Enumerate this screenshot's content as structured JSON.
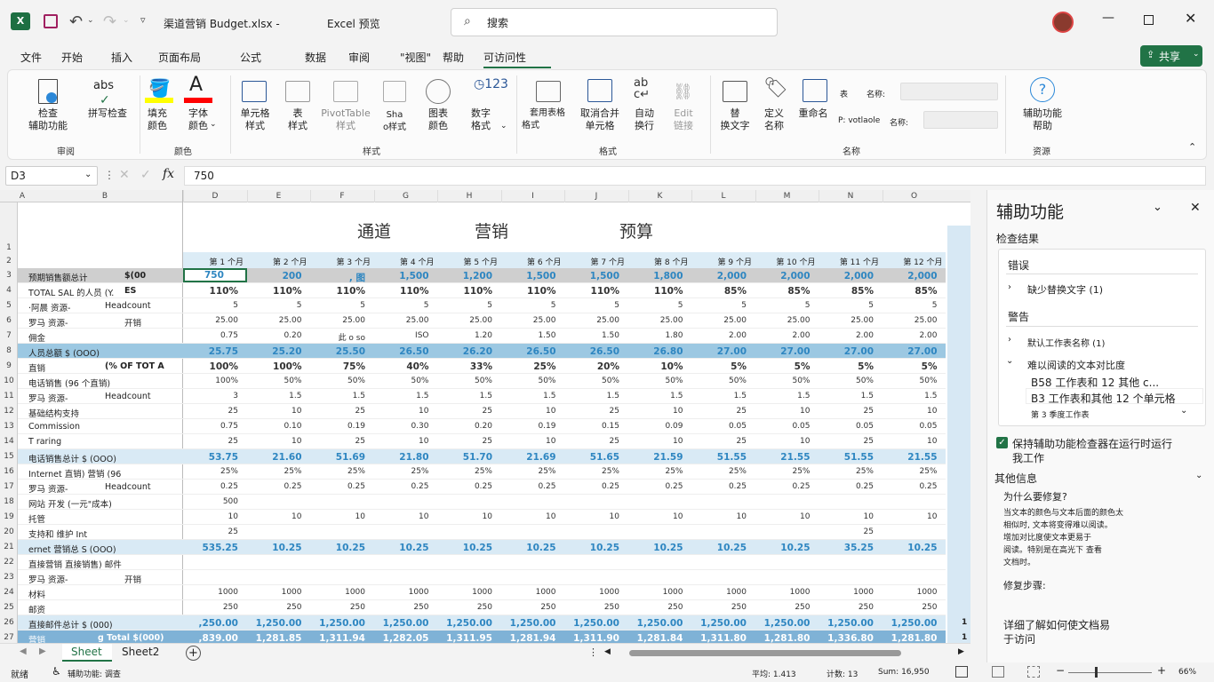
{
  "title": {
    "filename": "渠道营销 Budget.xlsx -",
    "app": "Excel 预览",
    "search": "搜索"
  },
  "menu": [
    "文件",
    "开始",
    "插入",
    "页面布局",
    "公式",
    "数据",
    "审阅",
    "\"视图\"",
    "帮助",
    "可访问性"
  ],
  "share": "共享",
  "ribbon": {
    "groups": [
      "审阅",
      "颜色",
      "样式",
      "格式",
      "名称",
      "资源"
    ],
    "buttons": [
      {
        "l1": "检查",
        "l2": "辅助功能"
      },
      {
        "l1": "拼写检查",
        "l2": ""
      },
      {
        "l1": "填充",
        "l2": "颜色"
      },
      {
        "l1": "字体",
        "l2": "颜色"
      },
      {
        "l1": "单元格",
        "l2": "样式"
      },
      {
        "l1": "表",
        "l2": "样式"
      },
      {
        "l1": "PivotTable",
        "l2": "样式"
      },
      {
        "l1": "Sha",
        "l2": "o样式"
      },
      {
        "l1": "图表",
        "l2": "颜色"
      },
      {
        "l1": "数字",
        "l2": "格式"
      },
      {
        "l1": "套用表格",
        "l2": "格式"
      },
      {
        "l1": "取消合并",
        "l2": "单元格"
      },
      {
        "l1": "自动",
        "l2": "换行"
      },
      {
        "l1": "Edit",
        "l2": "链接"
      },
      {
        "l1": "替",
        "l2": "换文字"
      },
      {
        "l1": "定义",
        "l2": "名称"
      },
      {
        "l1": "重命名",
        "l2": ""
      },
      {
        "l1": "辅助功能",
        "l2": "帮助"
      }
    ],
    "name_rows": [
      {
        "pre": "表",
        "label": "名称:"
      },
      {
        "pre": "P: votlaole",
        "label": "名称:"
      }
    ],
    "abs_text": "abs"
  },
  "formula": {
    "cellref": "D3",
    "value": "750"
  },
  "columns": [
    "A",
    "B",
    "D",
    "E",
    "F",
    "G",
    "H",
    "I",
    "J",
    "K",
    "L",
    "M",
    "N",
    "O"
  ],
  "header_words": [
    "通道",
    "营销",
    "预算"
  ],
  "months": [
    "第 1 个月",
    "第 2 个月",
    "第 3 个月",
    "第 4 个月",
    "第 5 个月",
    "第 6 个月",
    "第 7 个月",
    "第 8 个月",
    "第 9 个月",
    "第 10 个月",
    "第 11 个月",
    "第 12 个月"
  ],
  "rows": [
    {
      "n": "3",
      "label": "预期销售额总计",
      "label2": "$(00",
      "vals": [
        "750",
        "200",
        ", 图",
        "1,500",
        "1,200",
        "1,500",
        "1,500",
        "1,800",
        "2,000",
        "2,000",
        "2,000",
        "2,000"
      ],
      "style": "bold",
      "bg": "#cfcfcf"
    },
    {
      "n": "4",
      "label": "TOTAL SAL 的人员 (Y.",
      "label2": "ES",
      "vals": [
        "110%",
        "110%",
        "110%",
        "110%",
        "110%",
        "110%",
        "110%",
        "110%",
        "85%",
        "85%",
        "85%",
        "85%"
      ],
      "style": "bold"
    },
    {
      "n": "5",
      "label": "·阿晨    资源-",
      "label2": "Headcount",
      "vals": [
        "5",
        "5",
        "5",
        "5",
        "5",
        "5",
        "5",
        "5",
        "5",
        "5",
        "5",
        "5"
      ]
    },
    {
      "n": "6",
      "label": "罗马    资源-",
      "label2": "开销",
      "vals": [
        "25.00",
        "25.00",
        "25.00",
        "25.00",
        "25.00",
        "25.00",
        "25.00",
        "25.00",
        "25.00",
        "25.00",
        "25.00",
        "25.00"
      ]
    },
    {
      "n": "7",
      "label": "佣金",
      "label2": "",
      "vals": [
        "0.75",
        "0.20",
        "此 o so",
        "ISO",
        "1.20",
        "1.50",
        "1.50",
        "1.80",
        "2.00",
        "2.00",
        "2.00",
        "2.00"
      ]
    },
    {
      "n": "8",
      "label": "人员总额 $ (OOO)",
      "label2": "",
      "vals": [
        "25.75",
        "25.20",
        "25.50",
        "26.50",
        "26.20",
        "26.50",
        "26.50",
        "26.80",
        "27.00",
        "27.00",
        "27.00",
        "27.00"
      ],
      "style": "bluebold",
      "bg": "#9cc8e2"
    },
    {
      "n": "9",
      "label": "直销",
      "label2": "(% OF TOT  A",
      "vals": [
        "100%",
        "100%",
        "75%",
        "40%",
        "33%",
        "25%",
        "20%",
        "10%",
        "5%",
        "5%",
        "5%",
        "5%"
      ],
      "style": "bold"
    },
    {
      "n": "10",
      "label": "电话销售 (96 个直销)",
      "label2": "",
      "vals": [
        "100%",
        "50%",
        "50%",
        "50%",
        "50%",
        "50%",
        "50%",
        "50%",
        "50%",
        "50%",
        "50%",
        "50%"
      ]
    },
    {
      "n": "11",
      "label": "罗马    资源-",
      "label2": "Headcount",
      "vals": [
        "3",
        "1.5",
        "1.5",
        "1.5",
        "1.5",
        "1.5",
        "1.5",
        "1.5",
        "1.5",
        "1.5",
        "1.5",
        "1.5"
      ]
    },
    {
      "n": "12",
      "label": "基础结构支持",
      "label2": "",
      "vals": [
        "25",
        "10",
        "25",
        "10",
        "25",
        "10",
        "25",
        "10",
        "25",
        "10",
        "25",
        "10"
      ]
    },
    {
      "n": "13",
      "label": "Commission",
      "label2": "",
      "vals": [
        "0.75",
        "0.10",
        "0.19",
        "0.30",
        "0.20",
        "0.19",
        "0.15",
        "0.09",
        "0.05",
        "0.05",
        "0.05",
        "0.05"
      ]
    },
    {
      "n": "14",
      "label": "T raring",
      "label2": "",
      "vals": [
        "25",
        "10",
        "25",
        "10",
        "25",
        "10",
        "25",
        "10",
        "25",
        "10",
        "25",
        "10"
      ]
    },
    {
      "n": "15",
      "label": "电话销售总计 $ (OOO)",
      "label2": "",
      "vals": [
        "53.75",
        "21.60",
        "51.69",
        "21.80",
        "51.70",
        "21.69",
        "51.65",
        "21.59",
        "51.55",
        "21.55",
        "51.55",
        "21.55"
      ],
      "style": "bluebold",
      "bg": "#d9eaf5"
    },
    {
      "n": "16",
      "label": "Internet 直销) 营销 (96",
      "label2": "",
      "vals": [
        "25%",
        "25%",
        "25%",
        "25%",
        "25%",
        "25%",
        "25%",
        "25%",
        "25%",
        "25%",
        "25%",
        "25%"
      ]
    },
    {
      "n": "17",
      "label": "罗马    资源-",
      "label2": "Headcount",
      "vals": [
        "0.25",
        "0.25",
        "0.25",
        "0.25",
        "0.25",
        "0.25",
        "0.25",
        "0.25",
        "0.25",
        "0.25",
        "0.25",
        "0.25"
      ]
    },
    {
      "n": "18",
      "label": "网站      开发 (一元\"成本)",
      "label2": "",
      "vals": [
        "500",
        "",
        "",
        "",
        "",
        "",
        "",
        "",
        "",
        "",
        "",
        ""
      ]
    },
    {
      "n": "19",
      "label": "托管",
      "label2": "",
      "vals": [
        "10",
        "10",
        "10",
        "10",
        "10",
        "10",
        "10",
        "10",
        "10",
        "10",
        "10",
        "10"
      ]
    },
    {
      "n": "20",
      "label": "支持和          维护 Int",
      "label2": "",
      "vals": [
        "25",
        "",
        "",
        "",
        "",
        "",
        "",
        "",
        "",
        "",
        "25",
        ""
      ]
    },
    {
      "n": "21",
      "label": "ernet 营销总 S (OOO)",
      "label2": "",
      "vals": [
        "535.25",
        "10.25",
        "10.25",
        "10.25",
        "10.25",
        "10.25",
        "10.25",
        "10.25",
        "10.25",
        "10.25",
        "35.25",
        "10.25"
      ],
      "style": "bluebold",
      "bg": "#d9eaf5"
    },
    {
      "n": "22",
      "label": "直接营销 直接销售) 邮件",
      "label2": "",
      "vals": [
        "",
        "",
        "",
        "",
        "",
        "",
        "",
        "",
        "",
        "",
        "",
        ""
      ]
    },
    {
      "n": "23",
      "label": "罗马    资源-",
      "label2": "开销",
      "vals": [
        "",
        "",
        "",
        "",
        "",
        "",
        "",
        "",
        "",
        "",
        "",
        ""
      ]
    },
    {
      "n": "24",
      "label": "材料",
      "label2": "",
      "vals": [
        "1000",
        "1000",
        "1000",
        "1000",
        "1000",
        "1000",
        "1000",
        "1000",
        "1000",
        "1000",
        "1000",
        "1000"
      ]
    },
    {
      "n": "25",
      "label": "邮资",
      "label2": "",
      "vals": [
        "250",
        "250",
        "250",
        "250",
        "250",
        "250",
        "250",
        "250",
        "250",
        "250",
        "250",
        "250"
      ]
    },
    {
      "n": "26",
      "label": "直接邮件总计 $ (000)",
      "label2": "",
      "vals": [
        ",250.00",
        "1,250.00",
        "1,250.00",
        "1,250.00",
        "1,250.00",
        "1,250.00",
        "1,250.00",
        "1,250.00",
        "1,250.00",
        "1,250.00",
        "1,250.00",
        "1,250.00"
      ],
      "style": "bluebold",
      "bg": "#d9eaf5"
    },
    {
      "n": "27",
      "label": "营销",
      "label2": "g Total $(000)",
      "vals": [
        ",839.00",
        "1,281.85",
        "1,311.94",
        "1,282.05",
        "1,311.95",
        "1,281.94",
        "1,311.90",
        "1,281.84",
        "1,311.80",
        "1,281.80",
        "1,336.80",
        "1,281.80"
      ],
      "style": "whitebold",
      "bg": "#7fb2d6"
    }
  ],
  "row2_num": "2",
  "row1_num": "1",
  "extra_right": "1",
  "sheets": [
    "Sheet",
    "Sheet2"
  ],
  "status": {
    "ready": "就绪",
    "access": "辅助功能: 调查",
    "avg": "平均: 1.413",
    "count": "计数: 13",
    "sum": "Sum: 16,950",
    "zoom": "66%"
  },
  "pane": {
    "title": "辅助功能",
    "results": "检查结果",
    "errors": "错误",
    "err1": "缺少替换文字 (1)",
    "warnings": "警告",
    "warn1": "默认工作表名称 (1)",
    "warn2": "难以阅读的文本对比度",
    "sub1": "B58 工作表和 12 其他 c...",
    "sub2": "B3 工作表和其他 12 个单元格",
    "sub3": "第 3 季度工作表",
    "keep1": "保持辅助功能检查器在运行时运行",
    "keep2": "我工作",
    "more": "其他信息",
    "why": "为什么要修复?",
    "why_text": [
      "当文本的颜色与文本后面的颜色太",
      "相似时, 文本将变得难以阅读。",
      "增加对比度使文本更易于",
      "阅读。特别是在高光下 查看",
      "文档时。"
    ],
    "fix": "修复步骤:",
    "learn1": "详细了解如何使文档易",
    "learn2": "于访问"
  }
}
